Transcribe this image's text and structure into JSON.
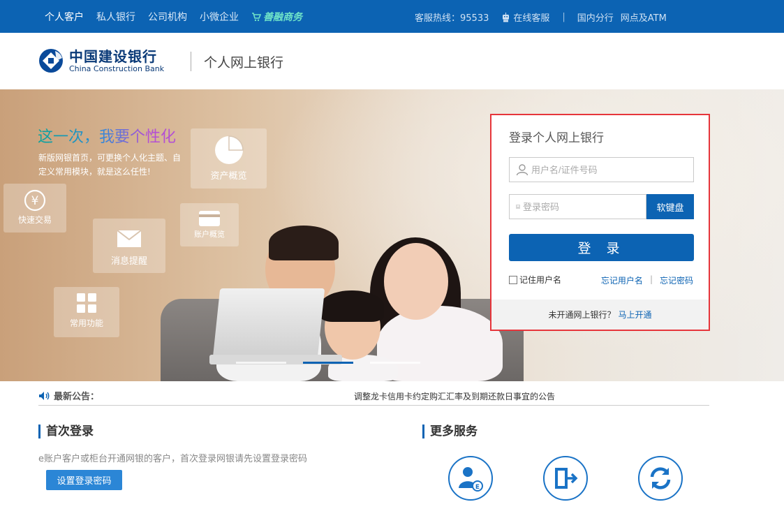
{
  "topnav": {
    "items": [
      "个人客户",
      "私人银行",
      "公司机构",
      "小微企业"
    ],
    "shop_label": "善融商务",
    "hotline": "客服热线：95533",
    "online_service": "在线客服",
    "branch": "国内分行",
    "atm": "网点及ATM"
  },
  "header": {
    "logo_cn": "中国建设银行",
    "logo_en": "China Construction Bank",
    "subtitle": "个人网上银行"
  },
  "hero": {
    "slogan": "这一次，我要个性化",
    "desc": "新版网银首页，可更换个人化主题、自定义常用模块，就是这么任性!",
    "tiles": {
      "assets": "资产概览",
      "quick_trade": "快速交易",
      "account": "账户概览",
      "messages": "消息提醒",
      "common": "常用功能"
    }
  },
  "login": {
    "title": "登录个人网上银行",
    "username_placeholder": "用户名/证件号码",
    "password_placeholder": "登录密码",
    "keyboard_label": "软键盘",
    "submit_label": "登 录",
    "remember_label": "记住用户名",
    "forgot_username": "忘记用户名",
    "forgot_password": "忘记密码",
    "signup_prompt": "未开通网上银行？",
    "signup_link": "马上开通"
  },
  "notice": {
    "label": "最新公告：",
    "text": "调整龙卡信用卡约定购汇汇率及到期还款日事宜的公告"
  },
  "first_login": {
    "title": "首次登录",
    "tip": "e账户客户或柜台开通网银的客户，首次登录网银请先设置登录密码",
    "button": "设置登录密码"
  },
  "more_services": {
    "title": "更多服务"
  },
  "colors": {
    "brand_blue": "#0c63b3",
    "highlight_red": "#e6353b"
  }
}
